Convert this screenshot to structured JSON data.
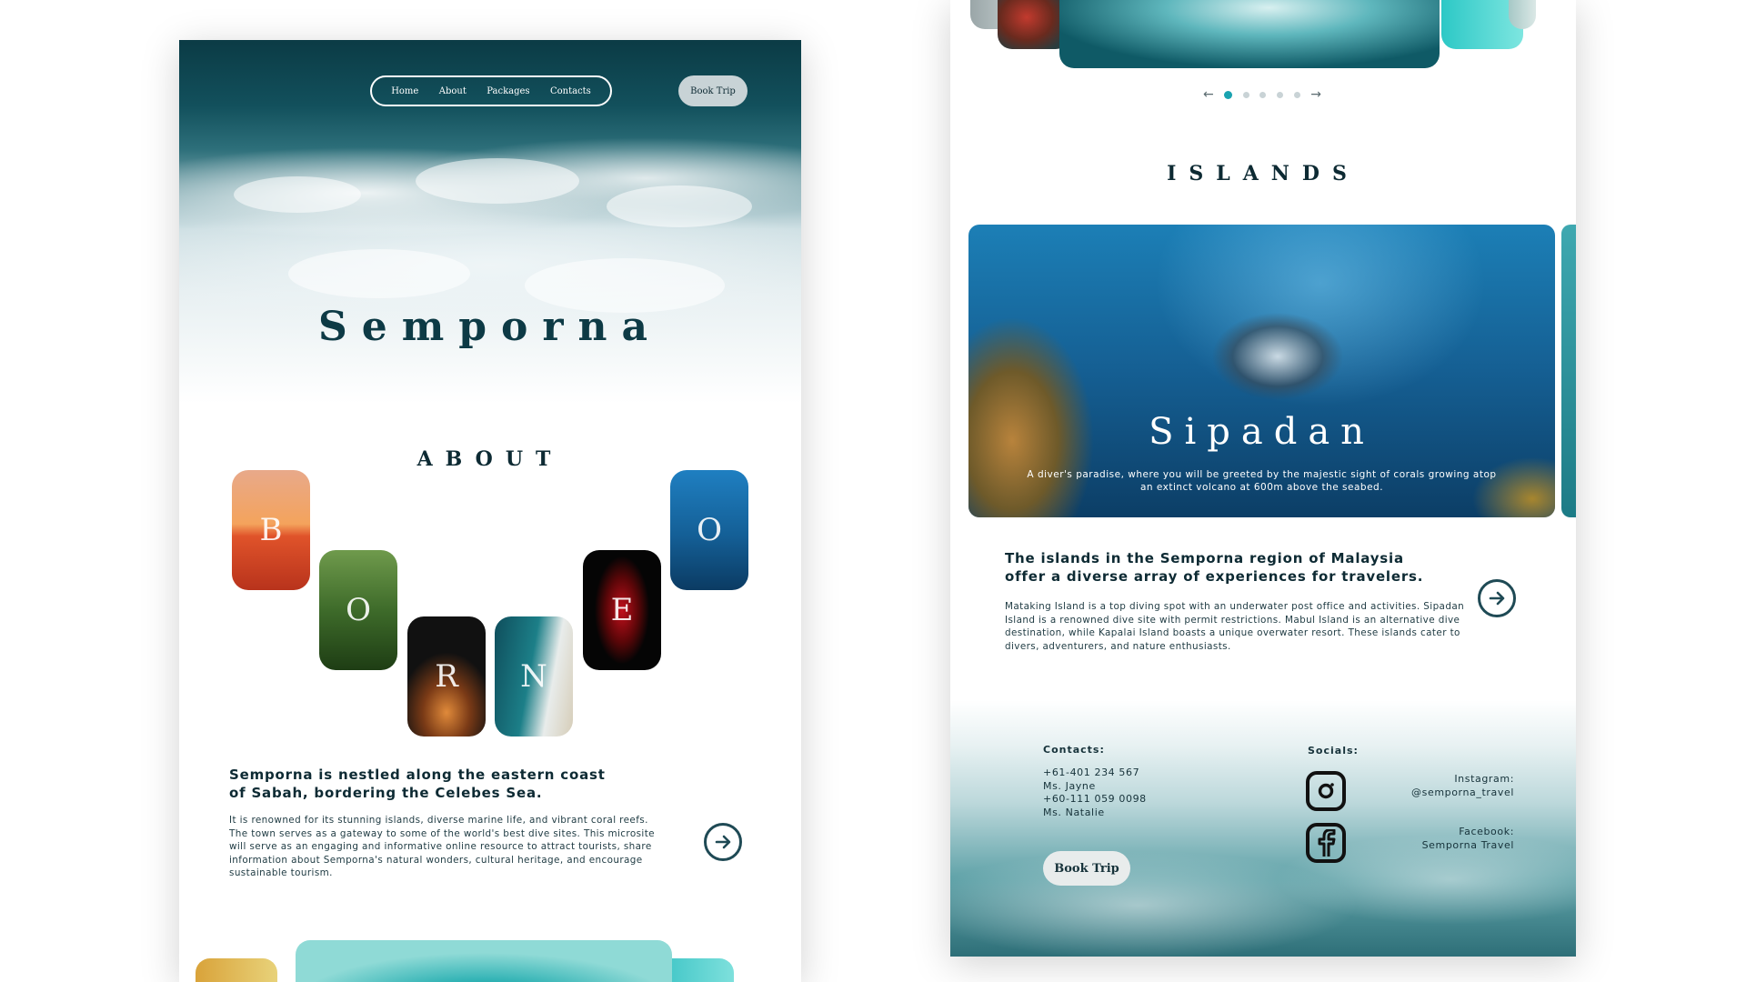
{
  "left_page": {
    "nav": {
      "links": [
        "Home",
        "About",
        "Packages",
        "Contacts"
      ],
      "book_button": "Book Trip"
    },
    "hero_title": "Semporna",
    "about": {
      "heading": "ABOUT",
      "letters": [
        "B",
        "O",
        "R",
        "N",
        "E",
        "O"
      ],
      "subheading": "Semporna is nestled along the eastern coast of Sabah, bordering the Celebes Sea.",
      "body": "It is renowned for its stunning islands, diverse marine life, and vibrant coral reefs. The town serves as a gateway to some of the world's best dive sites. This microsite will serve as an engaging and informative online resource to attract tourists, share information about Semporna's natural wonders, cultural heritage, and encourage sustainable tourism."
    }
  },
  "right_page": {
    "carousel": {
      "prev_arrow": "←",
      "next_arrow": "→",
      "dot_count": 5,
      "active_dot": 0
    },
    "islands": {
      "heading": "ISLANDS",
      "card_title": "Sipadan",
      "card_desc": "A diver's paradise, where you will be greeted by the majestic sight of corals growing atop an extinct volcano at 600m above the seabed.",
      "subheading": "The islands in the Semporna region of Malaysia offer a diverse array of experiences for travelers.",
      "body": "Mataking Island is a top diving spot with an underwater post office and activities. Sipadan Island is a renowned dive site with permit restrictions. Mabul Island is an alternative dive destination, while Kapalai Island boasts a unique overwater resort. These islands cater to divers, adventurers, and nature enthusiasts."
    },
    "footer": {
      "contacts_label": "Contacts:",
      "contacts": [
        "+61-401 234 567",
        "Ms. Jayne",
        "+60-111 059 0098",
        "Ms. Natalie"
      ],
      "book_button": "Book Trip",
      "socials_label": "Socials:",
      "instagram_label": "Instagram:",
      "instagram_handle": "@semporna_travel",
      "facebook_label": "Facebook:",
      "facebook_handle": "Semporna Travel"
    }
  },
  "colors": {
    "deep_teal": "#0d3a45",
    "accent": "#1aa3b0",
    "text": "#0d2a33"
  }
}
